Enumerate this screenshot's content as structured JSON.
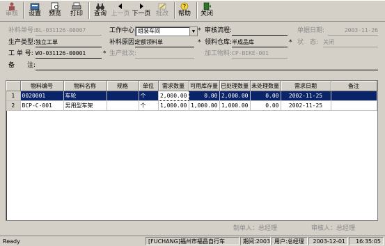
{
  "toolbar": {
    "buttons": [
      {
        "label": "审核",
        "disabled": true
      },
      {
        "label": "设置",
        "disabled": false
      },
      {
        "label": "预览",
        "disabled": false
      },
      {
        "label": "打印",
        "disabled": false
      },
      {
        "label": "查询",
        "disabled": false
      },
      {
        "label": "上一页",
        "disabled": true
      },
      {
        "label": "下一页",
        "disabled": false
      },
      {
        "label": "批改",
        "disabled": true
      },
      {
        "label": "帮助",
        "disabled": false
      },
      {
        "label": "关闭",
        "disabled": false
      }
    ]
  },
  "form": {
    "supp_no_label": "补料单号:",
    "supp_no_value": "BL-031126-00007",
    "work_center_label": "工作中心:",
    "work_center_value": "组装车间",
    "approval_flow_label": "审核流程:",
    "doc_date_label": "单据日期:",
    "doc_date_value": "2003-11-26",
    "prod_type_label": "生产类型:",
    "prod_type_value": "独立工单",
    "supp_reason_label": "补料原因:",
    "supp_reason_value": "定额领料单",
    "issue_wh_label": "领料仓库:",
    "issue_wh_value": "半成品库",
    "status_label": "状　态:",
    "status_value": "关闭",
    "wo_no_label": "工 单 号:",
    "wo_no_value": "WO-031126-00001",
    "batch_label": "生产批次:",
    "proc_item_label": "加工物料:",
    "proc_item_value": "CP-BIKE-001",
    "remark_label": "备　　注:",
    "star": "*"
  },
  "grid": {
    "headers": [
      "",
      "物料编号",
      "物料名称",
      "规格",
      "单位",
      "需求数量",
      "可用库存量",
      "已处理数量",
      "未处理数量",
      "需求日期",
      "备注"
    ],
    "rows": [
      [
        "1",
        "0020001",
        "车轮",
        "",
        "个",
        "2,000.00",
        "0.00",
        "2,000.00",
        "0.00",
        "2002-11-25",
        ""
      ],
      [
        "2",
        "BCP-C-001",
        "男用型车架",
        "",
        "个",
        "1,000.00",
        "1,000.00",
        "1,000.00",
        "0.00",
        "2002-11-25",
        ""
      ]
    ]
  },
  "footer": {
    "maker": "制单人：总经理",
    "approver": "审核人：总经理"
  },
  "status": {
    "ready": "Ready",
    "company": "[FUCHANG]福州市福昌自行车",
    "period": "期间:2003.12",
    "user": "用户:总经理",
    "date": "2003-12-01",
    "time": "16:35:05"
  }
}
